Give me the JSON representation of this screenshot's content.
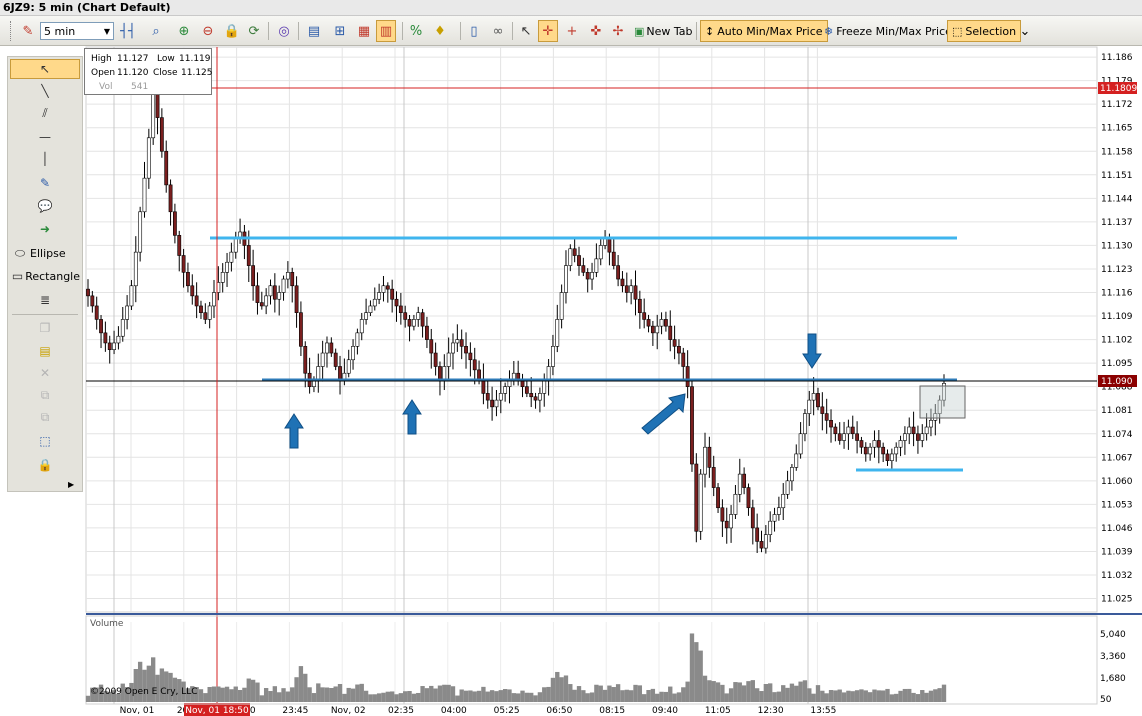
{
  "window": {
    "title": "6JZ9: 5 min (Chart Default)"
  },
  "toolbar": {
    "interval": "5 min",
    "new_tab_label": "New Tab",
    "auto_minmax_label": "Auto Min/Max Price",
    "freeze_minmax_label": "Freeze Min/Max Price",
    "selection_label": "Selection"
  },
  "left_tools": {
    "ellipse_label": "Ellipse",
    "rectangle_label": "Rectangle"
  },
  "info": {
    "high_label": "High",
    "high": "11.127",
    "low_label": "Low",
    "low": "11.119",
    "open_label": "Open",
    "open": "11.120",
    "close_label": "Close",
    "close": "11.125",
    "vol_label": "Vol",
    "vol": "541"
  },
  "chart_data": {
    "type": "candlestick",
    "price_axis_ticks": [
      "11.186",
      "11.179",
      "11.172",
      "11.165",
      "11.158",
      "11.151",
      "11.144",
      "11.137",
      "11.130",
      "11.123",
      "11.116",
      "11.109",
      "11.102",
      "11.095",
      "11.088",
      "11.081",
      "11.074",
      "11.067",
      "11.060",
      "11.053",
      "11.046",
      "11.039",
      "11.032",
      "11.025"
    ],
    "time_axis_ticks": [
      "Nov, 01",
      "20:55",
      "22:20",
      "23:45",
      "Nov, 02",
      "02:35",
      "04:00",
      "05:25",
      "06:50",
      "08:15",
      "09:40",
      "11:05",
      "12:30",
      "13:55"
    ],
    "cursor_time_label": "Nov, 01 18:50",
    "cursor_price_label": "11.1809",
    "last_price_label": "11.090",
    "volume_axis_ticks": [
      "5,040",
      "3,360",
      "1,680",
      "50"
    ],
    "volume_label": "Volume",
    "copyright": "©2009 Open E Cry, LLC",
    "ylim": [
      11.021,
      11.189
    ],
    "close_series": [
      11.115,
      11.112,
      11.108,
      11.104,
      11.101,
      11.099,
      11.101,
      11.103,
      11.108,
      11.112,
      11.118,
      11.128,
      11.14,
      11.15,
      11.162,
      11.176,
      11.168,
      11.158,
      11.148,
      11.14,
      11.133,
      11.127,
      11.122,
      11.118,
      11.115,
      11.112,
      11.11,
      11.108,
      11.112,
      11.116,
      11.119,
      11.122,
      11.125,
      11.128,
      11.132,
      11.134,
      11.13,
      11.124,
      11.118,
      11.113,
      11.112,
      11.115,
      11.118,
      11.114,
      11.116,
      11.12,
      11.122,
      11.118,
      11.11,
      11.1,
      11.092,
      11.088,
      11.09,
      11.094,
      11.098,
      11.101,
      11.098,
      11.094,
      11.09,
      11.092,
      11.096,
      11.1,
      11.104,
      11.108,
      11.11,
      11.112,
      11.114,
      11.116,
      11.118,
      11.117,
      11.114,
      11.112,
      11.11,
      11.108,
      11.106,
      11.108,
      11.11,
      11.106,
      11.102,
      11.098,
      11.094,
      11.09,
      11.094,
      11.098,
      11.101,
      11.102,
      11.1,
      11.098,
      11.096,
      11.093,
      11.09,
      11.086,
      11.084,
      11.082,
      11.084,
      11.086,
      11.088,
      11.09,
      11.092,
      11.09,
      11.088,
      11.086,
      11.085,
      11.084,
      11.086,
      11.09,
      11.094,
      11.1,
      11.108,
      11.116,
      11.124,
      11.129,
      11.127,
      11.124,
      11.122,
      11.12,
      11.122,
      11.126,
      11.13,
      11.132,
      11.128,
      11.124,
      11.12,
      11.118,
      11.116,
      11.118,
      11.114,
      11.11,
      11.108,
      11.106,
      11.104,
      11.106,
      11.108,
      11.106,
      11.102,
      11.1,
      11.098,
      11.094,
      11.088,
      11.065,
      11.045,
      11.062,
      11.07,
      11.064,
      11.058,
      11.052,
      11.048,
      11.046,
      11.05,
      11.056,
      11.062,
      11.058,
      11.052,
      11.046,
      11.042,
      11.04,
      11.044,
      11.048,
      11.05,
      11.052,
      11.056,
      11.06,
      11.064,
      11.068,
      11.074,
      11.08,
      11.084,
      11.086,
      11.082,
      11.08,
      11.078,
      11.076,
      11.074,
      11.072,
      11.074,
      11.076,
      11.074,
      11.072,
      11.07,
      11.068,
      11.07,
      11.072,
      11.07,
      11.068,
      11.066,
      11.068,
      11.07,
      11.072,
      11.074,
      11.076,
      11.074,
      11.072,
      11.074,
      11.076,
      11.078,
      11.08,
      11.084,
      11.089
    ]
  }
}
